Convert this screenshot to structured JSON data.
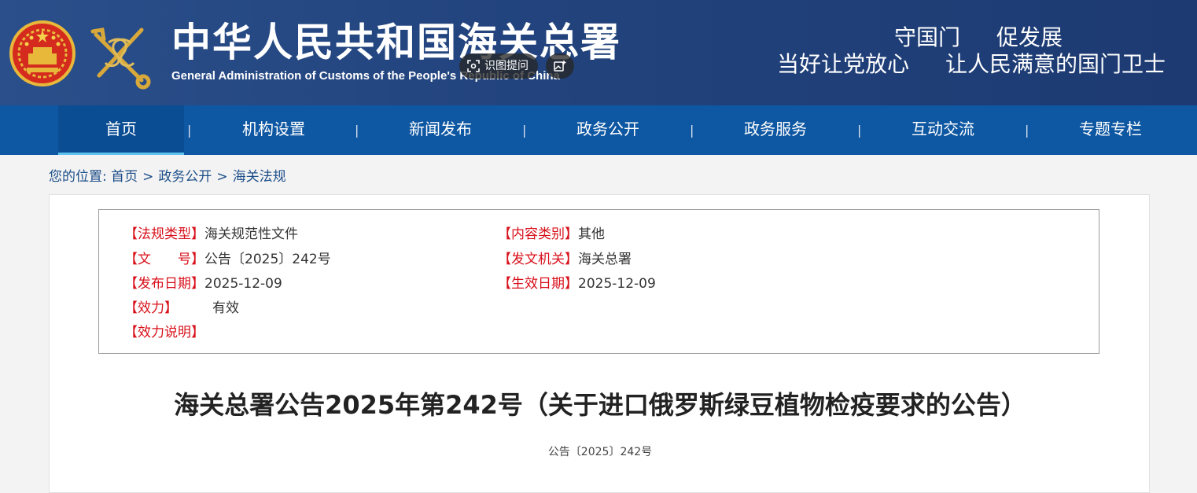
{
  "header": {
    "title": "中华人民共和国海关总署",
    "subtitle": "General Administration of Customs of the People's Republic of China",
    "slogan_line1": [
      "守国门",
      "促发展"
    ],
    "slogan_line2": [
      "当好让党放心",
      "让人民满意的国门卫士"
    ],
    "ocr_button_label": "识图提问"
  },
  "nav": {
    "items": [
      "首页",
      "机构设置",
      "新闻发布",
      "政务公开",
      "政务服务",
      "互动交流",
      "专题专栏"
    ],
    "active_index": 0,
    "separator": "|"
  },
  "breadcrumb": {
    "prefix": "您的位置:",
    "items": [
      "首页",
      "政务公开",
      "海关法规"
    ],
    "separator": ">"
  },
  "meta": {
    "law_type_label": "【法规类型】",
    "law_type_value": "海关规范性文件",
    "content_category_label": "【内容类别】",
    "content_category_value": "其他",
    "doc_no_label": "【文　　号】",
    "doc_no_value": "公告〔2025〕242号",
    "issuer_label": "【发文机关】",
    "issuer_value": "海关总署",
    "publish_date_label": "【发布日期】",
    "publish_date_value": "2025-12-09",
    "effective_date_label": "【生效日期】",
    "effective_date_value": "2025-12-09",
    "validity_label": "【效力】",
    "validity_value": "有效",
    "validity_note_label": "【效力说明】",
    "validity_note_value": ""
  },
  "document": {
    "title": "海关总署公告2025年第242号（关于进口俄罗斯绿豆植物检疫要求的公告）",
    "number": "公告〔2025〕242号"
  },
  "colors": {
    "header_bg": "#22437d",
    "nav_bg": "#0e57a2",
    "nav_active_underline": "#5ec3ef",
    "meta_label": "#d8101a",
    "breadcrumb": "#1d4e89"
  }
}
